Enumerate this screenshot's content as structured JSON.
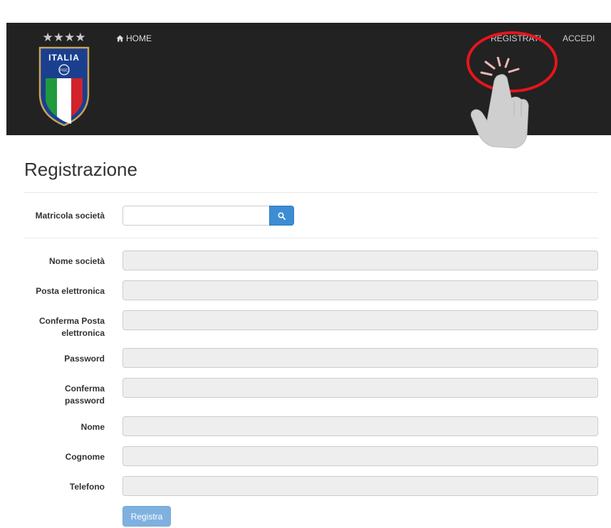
{
  "logo": {
    "stars": "★★★★",
    "text": "ITALIA",
    "badge": "FIGC"
  },
  "nav": {
    "home_label": "HOME",
    "register_label": "REGISTRATI",
    "login_label": "ACCEDI"
  },
  "page": {
    "title": "Registrazione"
  },
  "search": {
    "label": "Matricola società",
    "value": ""
  },
  "form": {
    "nome_societa": "Nome società",
    "posta": "Posta elettronica",
    "conferma_posta_1": "Conferma Posta",
    "conferma_posta_2": "elettronica",
    "password": "Password",
    "conferma_password_1": "Conferma",
    "conferma_password_2": "password",
    "nome": "Nome",
    "cognome": "Cognome",
    "telefono": "Telefono",
    "submit_label": "Registra"
  },
  "colors": {
    "navbar": "#222222",
    "primary": "#3c8dd3",
    "primary_disabled": "#7fb1e0",
    "highlight": "#e8141b"
  }
}
